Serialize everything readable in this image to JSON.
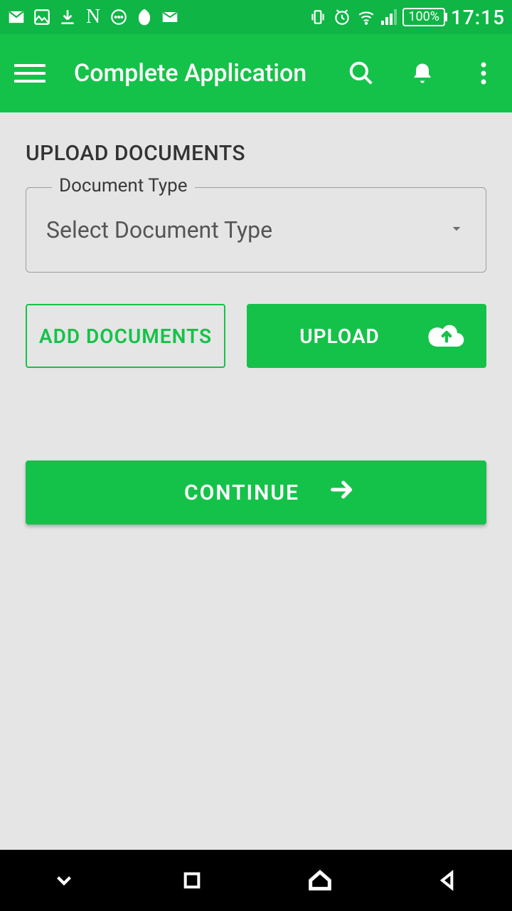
{
  "status_bar": {
    "battery_text": "100%",
    "time": "17:15"
  },
  "app_bar": {
    "title": "Complete Application"
  },
  "main": {
    "section_title": "UPLOAD DOCUMENTS",
    "doc_type_label": "Document Type",
    "doc_type_value": "Select Document Type",
    "add_documents_label": "ADD DOCUMENTS",
    "upload_label": "UPLOAD",
    "continue_label": "CONTINUE"
  },
  "colors": {
    "primary": "#15c249",
    "status_bar": "#0fb545"
  }
}
